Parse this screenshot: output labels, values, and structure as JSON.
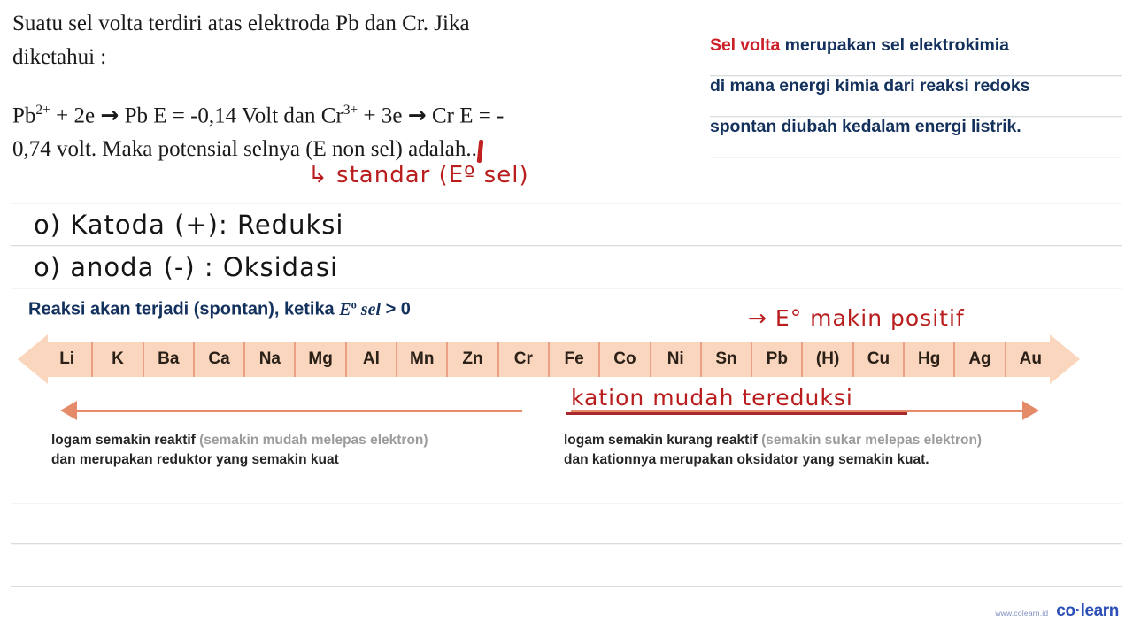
{
  "problem": {
    "line1": "Suatu sel volta terdiri atas elektroda Pb dan Cr. Jika",
    "line2": "diketahui :",
    "eq_part1": "Pb",
    "eq_sup1": "2+",
    "eq_part2": " + 2e ",
    "eq_arrow1": "→",
    "eq_part3": " Pb E = -0,14 Volt dan Cr",
    "eq_sup2": "3+",
    "eq_part4": " + 3e ",
    "eq_arrow2": "→",
    "eq_part5": " Cr E = -",
    "line4": "0,74 volt. Maka potensial selnya (E non sel) adalah..."
  },
  "definition": {
    "line1_highlight": "Sel volta",
    "line1_rest": " merupakan sel elektrokimia",
    "line2": "di mana energi kimia dari reaksi redoks",
    "line3": "spontan diubah kedalam energi listrik."
  },
  "annotations": {
    "standar": "↳ standar  (Eº sel)",
    "katoda": "o) Katoda (+): Reduksi",
    "anoda": "o) anoda (-) : Oksidasi",
    "e_makin_positif": "→  E° makin positif",
    "kation_mudah_tereduksi": "kation mudah tereduksi"
  },
  "spontan_heading": {
    "text": "Reaksi akan terjadi (spontan), ketika ",
    "symbol_E": "E",
    "symbol_sup": "o",
    "symbol_sel": " sel",
    "comparison": " > 0"
  },
  "series": {
    "elements": [
      "Li",
      "K",
      "Ba",
      "Ca",
      "Na",
      "Mg",
      "Al",
      "Mn",
      "Zn",
      "Cr",
      "Fe",
      "Co",
      "Ni",
      "Sn",
      "Pb",
      "(H)",
      "Cu",
      "Hg",
      "Ag",
      "Au"
    ],
    "bar_color": "#f9d6bd",
    "divider_color": "#e8a183"
  },
  "captions": {
    "left_bold1": "logam semakin reaktif ",
    "left_muted": "(semakin mudah melepas elektron)",
    "left_bold2": "dan merupakan reduktor yang semakin kuat",
    "right_bold1": "logam semakin kurang reaktif ",
    "right_muted": "(semakin sukar melepas elektron)",
    "right_bold2": "dan kationnya merupakan oksidator yang semakin kuat."
  },
  "logo": {
    "url": "www.colearn.id",
    "mark": "co·learn"
  }
}
